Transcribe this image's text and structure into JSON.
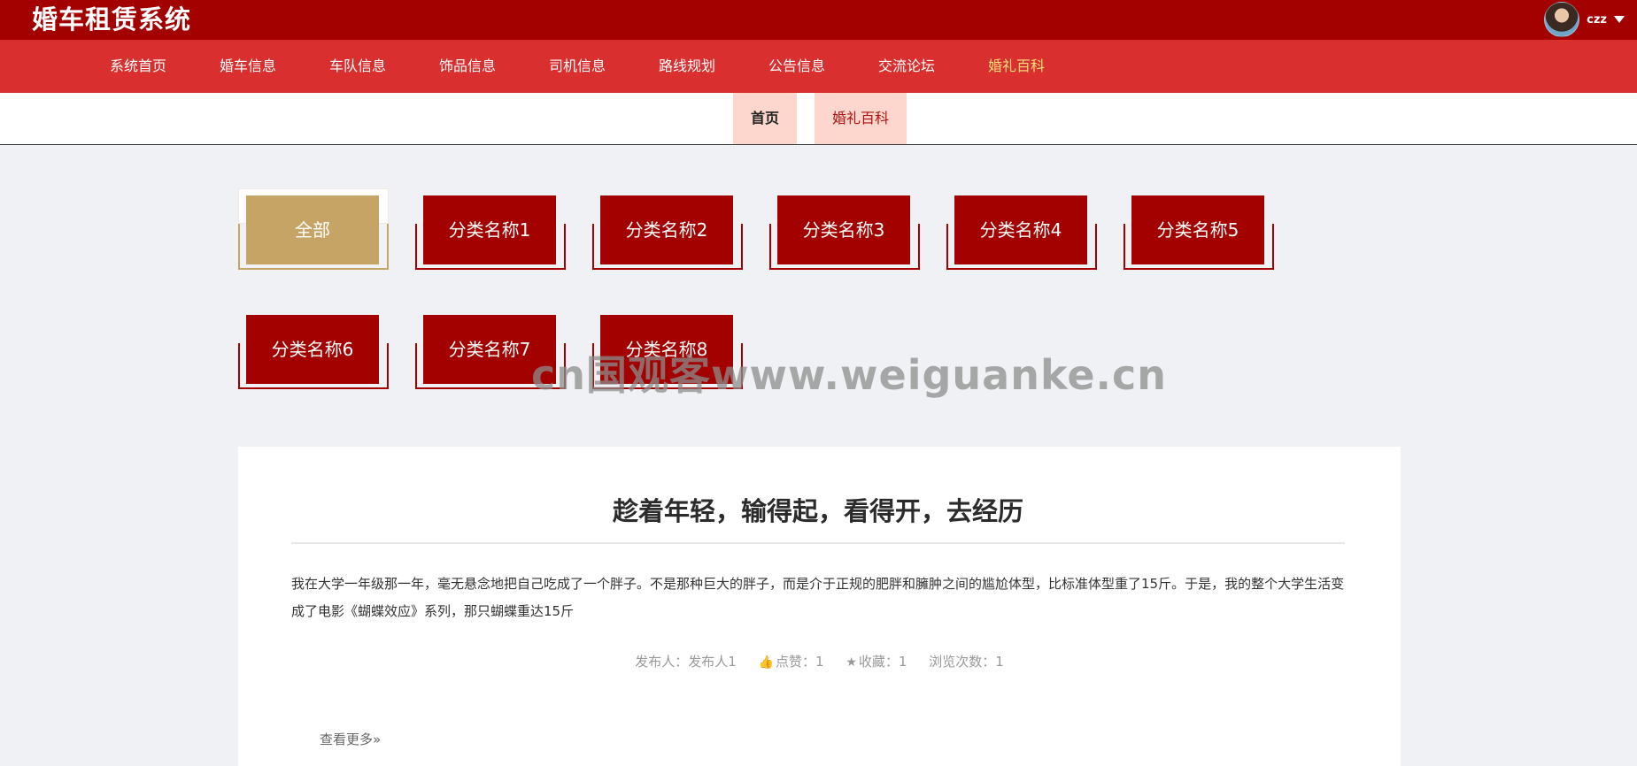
{
  "header": {
    "app_title": "婚车租赁系统",
    "username": "czz",
    "colors": {
      "primary": "#a30000",
      "nav": "#d92f2f",
      "active_nav": "#ffe07a",
      "gold": "#c6a466"
    }
  },
  "nav": {
    "items": [
      {
        "label": "系统首页"
      },
      {
        "label": "婚车信息"
      },
      {
        "label": "车队信息"
      },
      {
        "label": "饰品信息"
      },
      {
        "label": "司机信息"
      },
      {
        "label": "路线规划"
      },
      {
        "label": "公告信息"
      },
      {
        "label": "交流论坛"
      },
      {
        "label": "婚礼百科"
      }
    ],
    "active": "婚礼百科"
  },
  "breadcrumb": {
    "home": "首页",
    "current": "婚礼百科"
  },
  "categories": [
    {
      "label": "全部",
      "selected": true
    },
    {
      "label": "分类名称1"
    },
    {
      "label": "分类名称2"
    },
    {
      "label": "分类名称3"
    },
    {
      "label": "分类名称4"
    },
    {
      "label": "分类名称5"
    },
    {
      "label": "分类名称6"
    },
    {
      "label": "分类名称7"
    },
    {
      "label": "分类名称8"
    }
  ],
  "article": {
    "title": "趁着年轻，输得起，看得开，去经历",
    "body": "我在大学一年级那一年，毫无悬念地把自己吃成了一个胖子。不是那种巨大的胖子，而是介于正规的肥胖和臃肿之间的尴尬体型，比标准体型重了15斤。于是，我的整个大学生活变成了电影《蝴蝶效应》系列，那只蝴蝶重达15斤",
    "meta": {
      "publisher": "发布人：发布人1",
      "likes": "点赞：1",
      "favorites": "收藏：1",
      "views": "浏览次数：1"
    },
    "more": "查看更多»"
  },
  "watermark": "cn国观客www.weiguanke.cn"
}
